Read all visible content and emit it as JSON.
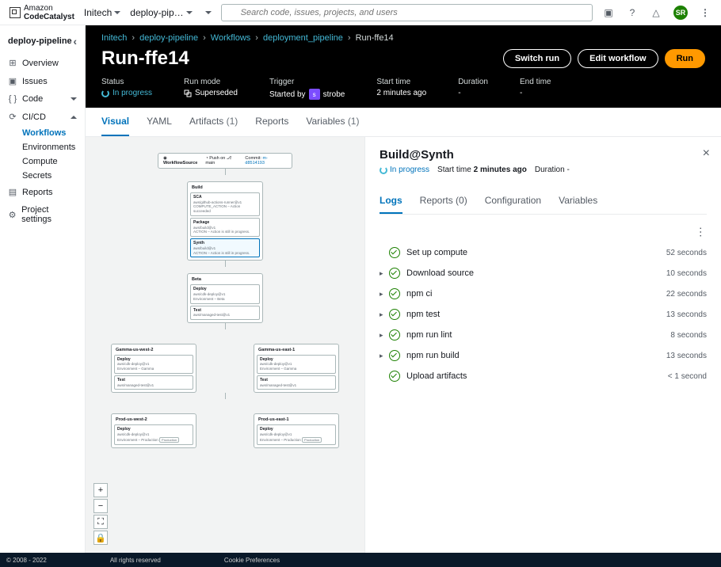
{
  "brand": {
    "line1": "Amazon",
    "line2": "CodeCatalyst"
  },
  "topbar": {
    "space": "Initech",
    "project": "deploy-pip…",
    "search_placeholder": "Search code, issues, projects, and users",
    "avatar": "SR"
  },
  "sidebar": {
    "title": "deploy-pipeline",
    "items": [
      {
        "icon": "⊞",
        "label": "Overview"
      },
      {
        "icon": "▣",
        "label": "Issues"
      },
      {
        "icon": "{ }",
        "label": "Code",
        "expandable": true
      },
      {
        "icon": "⟳",
        "label": "CI/CD",
        "expandable": true,
        "expanded": true,
        "children": [
          {
            "label": "Workflows",
            "active": true
          },
          {
            "label": "Environments"
          },
          {
            "label": "Compute"
          },
          {
            "label": "Secrets"
          }
        ]
      },
      {
        "icon": "▤",
        "label": "Reports"
      },
      {
        "icon": "⚙",
        "label": "Project settings"
      }
    ]
  },
  "breadcrumb": [
    "Initech",
    "deploy-pipeline",
    "Workflows",
    "deployment_pipeline",
    "Run-ffe14"
  ],
  "run": {
    "title": "Run-ffe14",
    "buttons": {
      "switch": "Switch run",
      "edit": "Edit workflow",
      "run": "Run"
    },
    "meta": [
      {
        "label": "Status",
        "value": "In progress",
        "kind": "progress"
      },
      {
        "label": "Run mode",
        "value": "Superseded",
        "kind": "super"
      },
      {
        "label": "Trigger",
        "value": "Started by",
        "user": "strobe"
      },
      {
        "label": "Start time",
        "value": "2 minutes ago"
      },
      {
        "label": "Duration",
        "value": "-"
      },
      {
        "label": "End time",
        "value": "-"
      }
    ]
  },
  "tabs": [
    {
      "label": "Visual",
      "active": true
    },
    {
      "label": "YAML"
    },
    {
      "label": "Artifacts",
      "count": "(1)"
    },
    {
      "label": "Reports"
    },
    {
      "label": "Variables",
      "count": "(1)"
    }
  ],
  "wf": {
    "source": {
      "label": "WorkflowSource",
      "push": "Push on",
      "branch": "main",
      "commit": "Commit:",
      "sha": "m-d8514193"
    },
    "build": {
      "title": "Build",
      "actions": [
        {
          "name": "SCA",
          "sub": "aws/github-actions-runner@v1",
          "status": "COMPUTE_ACTION – Action succeeded"
        },
        {
          "name": "Package",
          "sub": "aws/build@v1",
          "status": "ACTION – Action is still in progress."
        },
        {
          "name": "Synth",
          "sub": "aws/build@v1",
          "status": "ACTION – Action is still in progress.",
          "selected": true
        }
      ]
    },
    "beta": {
      "title": "Beta",
      "actions": [
        {
          "name": "Deploy",
          "sub": "aws/cdk-deploy@v1",
          "status": "Environment – Beta"
        },
        {
          "name": "Test",
          "sub": "aws/managed-test@v1"
        }
      ]
    },
    "gamma": [
      {
        "title": "Gamma-us-west-2",
        "actions": [
          {
            "name": "Deploy",
            "sub": "aws/cdk-deploy@v1",
            "status": "Environment – Gamma"
          },
          {
            "name": "Test",
            "sub": "aws/managed-test@v1"
          }
        ]
      },
      {
        "title": "Gamma-us-east-1",
        "actions": [
          {
            "name": "Deploy",
            "sub": "aws/cdk-deploy@v1",
            "status": "Environment – Gamma"
          },
          {
            "name": "Test",
            "sub": "aws/managed-test@v1"
          }
        ]
      }
    ],
    "prod": [
      {
        "title": "Prod-us-west-2",
        "actions": [
          {
            "name": "Deploy",
            "sub": "aws/cdk-deploy@v1",
            "status": "Environment – Production",
            "pill": "Production"
          }
        ]
      },
      {
        "title": "Prod-us-east-1",
        "actions": [
          {
            "name": "Deploy",
            "sub": "aws/cdk-deploy@v1",
            "status": "Environment – Production",
            "pill": "Production"
          }
        ]
      }
    ]
  },
  "panel": {
    "title": "Build@Synth",
    "status": "In progress",
    "start_label": "Start time",
    "start": "2 minutes ago",
    "dur_label": "Duration",
    "dur": "-",
    "tabs": [
      {
        "label": "Logs",
        "active": true
      },
      {
        "label": "Reports",
        "count": "(0)"
      },
      {
        "label": "Configuration"
      },
      {
        "label": "Variables"
      }
    ],
    "logs": [
      {
        "name": "Set up compute",
        "time": "52 seconds",
        "expandable": false
      },
      {
        "name": "Download source",
        "time": "10 seconds",
        "expandable": true
      },
      {
        "name": "npm ci",
        "time": "22 seconds",
        "expandable": true
      },
      {
        "name": "npm test",
        "time": "13 seconds",
        "expandable": true
      },
      {
        "name": "npm run lint",
        "time": "8 seconds",
        "expandable": true
      },
      {
        "name": "npm run build",
        "time": "13 seconds",
        "expandable": true
      },
      {
        "name": "Upload artifacts",
        "time": "< 1 second",
        "expandable": false
      }
    ]
  },
  "footer": {
    "copy": "© 2008 - 2022",
    "rights": "All rights reserved",
    "cookie": "Cookie Preferences"
  }
}
